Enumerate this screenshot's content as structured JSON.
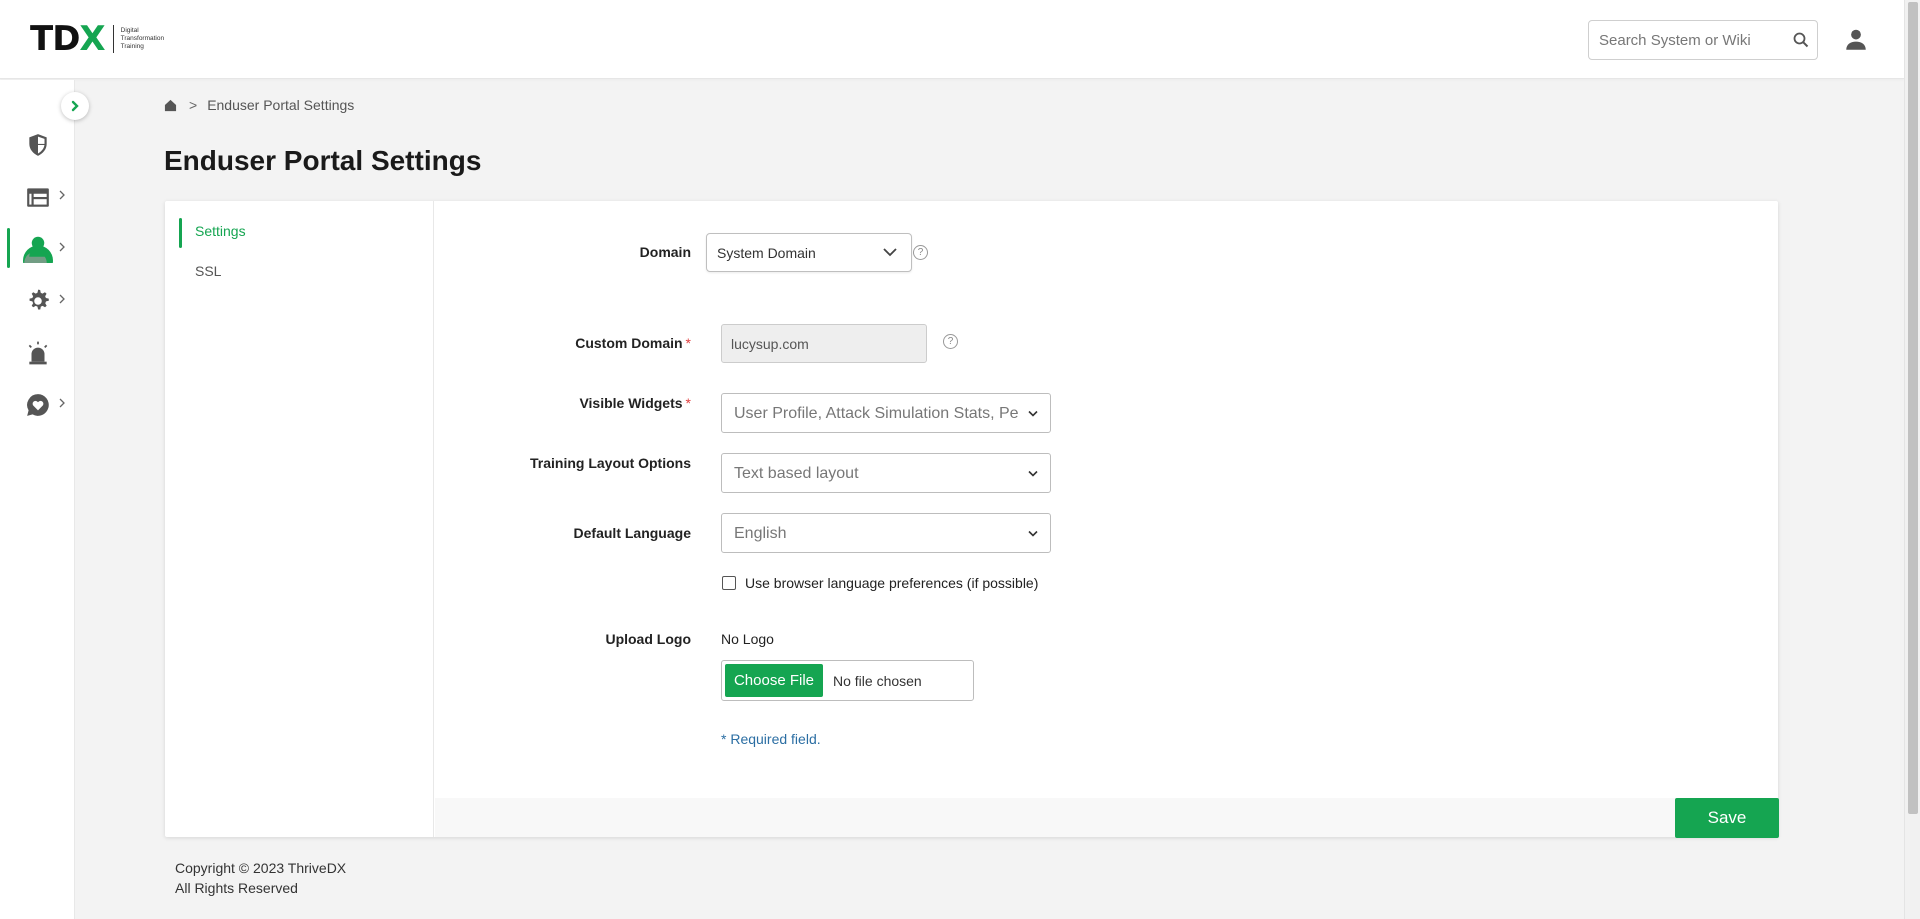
{
  "header": {
    "logo": {
      "mark_black": "TD",
      "mark_green": "X",
      "tagline": [
        "Digital",
        "Transformation",
        "Training"
      ]
    },
    "search": {
      "placeholder": "Search System or Wiki"
    }
  },
  "sidebar": {
    "items": [
      {
        "name": "security",
        "icon": "shield-icon",
        "has_children": false
      },
      {
        "name": "dashboard",
        "icon": "layout-icon",
        "has_children": true
      },
      {
        "name": "users",
        "icon": "user-icon",
        "has_children": true,
        "active": true
      },
      {
        "name": "settings",
        "icon": "gear-icon",
        "has_children": true
      },
      {
        "name": "alerts",
        "icon": "alarm-icon",
        "has_children": false
      },
      {
        "name": "support",
        "icon": "heart-chat-icon",
        "has_children": true
      }
    ]
  },
  "breadcrumb": {
    "current": "Enduser Portal Settings",
    "separator": ">"
  },
  "page": {
    "title": "Enduser Portal Settings"
  },
  "tabs": [
    {
      "label": "Settings",
      "active": true
    },
    {
      "label": "SSL",
      "active": false
    }
  ],
  "form": {
    "domain": {
      "label": "Domain",
      "value": "System Domain"
    },
    "custom_domain": {
      "label": "Custom Domain",
      "value": "lucysup.com",
      "required": "*"
    },
    "visible_widgets": {
      "label": "Visible Widgets",
      "value": "User Profile, Attack Simulation Stats, Pe",
      "required": "*"
    },
    "training_layout": {
      "label": "Training Layout Options",
      "value": "Text based layout"
    },
    "default_language": {
      "label": "Default Language",
      "value": "English"
    },
    "browser_lang": {
      "label": "Use browser language preferences (if possible)",
      "checked": false
    },
    "upload_logo": {
      "label": "Upload Logo",
      "current": "No Logo",
      "button": "Choose File",
      "status": "No file chosen"
    },
    "required_note": "* Required field.",
    "help_glyph": "?"
  },
  "actions": {
    "save": "Save"
  },
  "footer": {
    "line1": "Copyright © 2023 ThriveDX",
    "line2": "All Rights Reserved"
  },
  "colors": {
    "accent": "#15a551",
    "link": "#2b6ea3",
    "required": "#e04040"
  }
}
